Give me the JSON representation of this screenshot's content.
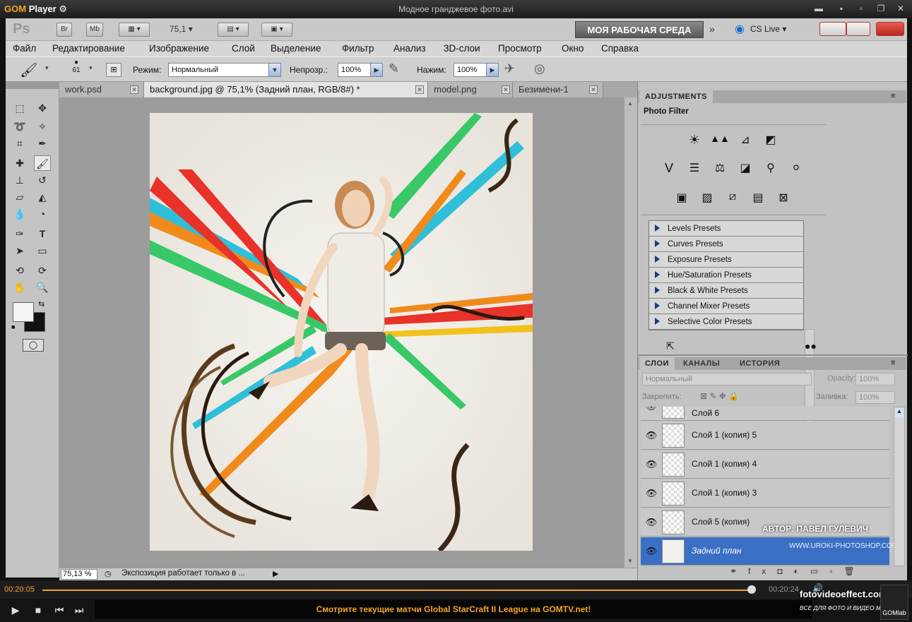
{
  "gom": {
    "logo_a": "GOM",
    "logo_b": "Player",
    "window_title": "Модное гранджевое фото.avi",
    "time_elapsed": "00:20:05",
    "time_total": "00:20:24",
    "ticker": "Смотрите текущие матчи Global StarCraft II League на GOMTV.net!",
    "gomlab": "GOMlab",
    "watermark_site": "fotovideoeffect.com",
    "watermark_sub": "ВСЕ ДЛЯ ФОТО И ВИДЕО МОНТАЖА!"
  },
  "appbar": {
    "logo": "Ps",
    "br": "Br",
    "mb": "Mb",
    "zoom": "75,1",
    "workspace": "МОЯ РАБОЧАЯ СРЕДА",
    "cslive": "CS Live"
  },
  "menu": [
    "Файл",
    "Редактирование",
    "Изображение",
    "Слой",
    "Выделение",
    "Фильтр",
    "Анализ",
    "3D-слои",
    "Просмотр",
    "Окно",
    "Справка"
  ],
  "options": {
    "brush_size": "61",
    "mode_label": "Режим:",
    "mode_value": "Нормальный",
    "opacity_label": "Непрозр.:",
    "opacity_value": "100%",
    "flow_label": "Нажим:",
    "flow_value": "100%"
  },
  "doc_tabs": [
    {
      "label": "work.psd"
    },
    {
      "label": "background.jpg @ 75,1% (Задний план, RGB/8#) *"
    },
    {
      "label": "model.png"
    },
    {
      "label": "Безимени-1"
    }
  ],
  "status": {
    "zoom": "75,13 %",
    "info": "Экспозиция работает только в ..."
  },
  "adjustments": {
    "tab": "ADJUSTMENTS",
    "title": "Photo Filter",
    "presets": [
      "Levels Presets",
      "Curves Presets",
      "Exposure Presets",
      "Hue/Saturation Presets",
      "Black & White Presets",
      "Channel Mixer Presets",
      "Selective Color Presets"
    ]
  },
  "layers": {
    "tabs": [
      "СЛОИ",
      "КАНАЛЫ",
      "ИСТОРИЯ"
    ],
    "blend_mode": "Нормальный",
    "opacity_label": "Opacity:",
    "opacity_value": "100%",
    "lock_label": "Закрепить:",
    "fill_label": "Заливка:",
    "fill_value": "100%",
    "items": [
      {
        "name": "Слой 6"
      },
      {
        "name": "Слой 1 (копия) 5"
      },
      {
        "name": "Слой 1 (копия) 4"
      },
      {
        "name": "Слой 1 (копия) 3"
      },
      {
        "name": "Слой 5 (копия)"
      },
      {
        "name": "Задний план"
      }
    ],
    "author": "АВТОР: ПАВЕЛ ГУЛЕВИЧ",
    "author_site": "WWW.UROKI-PHOTOSHOP.COM"
  },
  "colors": {
    "accent": "#f5a623",
    "selected_layer": "#3b6fc4"
  }
}
